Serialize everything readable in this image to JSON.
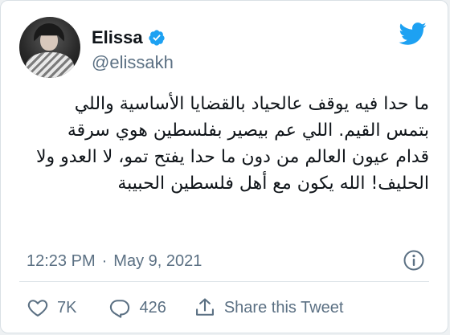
{
  "colors": {
    "accent": "#1da1f2",
    "text": "#0f1419",
    "muted": "#5b7083"
  },
  "author": {
    "display_name": "Elissa",
    "handle": "@elissakh",
    "verified": true,
    "avatar_icon": "profile-photo"
  },
  "header": {
    "logo_icon": "twitter-bird-icon"
  },
  "tweet": {
    "text": "ما حدا فيه يوقف عالحياد بالقضايا الأساسية واللي بتمس القيم. اللي عم بيصير بفلسطين هوي سرقة قدام عيون العالم من دون ما حدا يفتح تمو، لا العدو ولا الحليف! الله يكون مع أهل فلسطين الحبيبة",
    "time": "12:23 PM",
    "separator": "·",
    "date": "May 9, 2021"
  },
  "actions": {
    "likes": "7K",
    "replies": "426",
    "share_label": "Share this Tweet"
  }
}
